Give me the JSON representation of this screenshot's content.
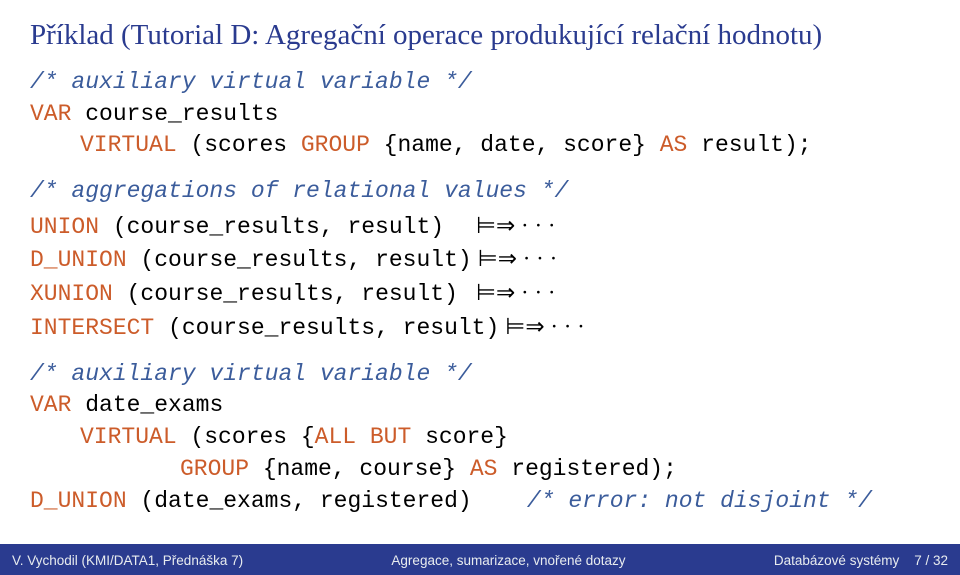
{
  "title": "Příklad (Tutorial D: Agregační operace produkující relační hodnotu)",
  "block1": {
    "c1": "/* auxiliary virtual variable */",
    "l1_kw": "VAR",
    "l1_rest": " course_results",
    "l2_kw": "VIRTUAL",
    "l2_rest": " (scores ",
    "l2_kw2": "GROUP",
    "l2_rest2": " {name, date, score} ",
    "l2_kw3": "AS",
    "l2_rest3": " result);"
  },
  "block2": {
    "c1": "/* aggregations of relational values */",
    "rows": [
      {
        "kw": "UNION",
        "rest": " (course_results, result)"
      },
      {
        "kw": "D_UNION",
        "rest": " (course_results, result)"
      },
      {
        "kw": "XUNION",
        "rest": " (course_results, result)"
      },
      {
        "kw": "INTERSECT",
        "rest": " (course_results, result)"
      }
    ],
    "arrow": "⊨⇒ · · ·"
  },
  "block3": {
    "c1": "/* auxiliary virtual variable */",
    "l1_kw": "VAR",
    "l1_rest": " date_exams",
    "l2_kw": "VIRTUAL",
    "l2_rest": " (scores {",
    "l2_kw2": "ALL BUT",
    "l2_rest2": " score}",
    "l3_kw": "GROUP",
    "l3_rest": " {name, course} ",
    "l3_kw2": "AS",
    "l3_rest2": " registered);",
    "l4_kw": "D_UNION",
    "l4_rest": " (date_exams, registered)",
    "l4_comment": "/* error: not disjoint */"
  },
  "footer": {
    "left": "V. Vychodil (KMI/DATA1, Přednáška 7)",
    "center": "Agregace, sumarizace, vnořené dotazy",
    "right_a": "Databázové systémy",
    "right_b": "7 / 32"
  }
}
